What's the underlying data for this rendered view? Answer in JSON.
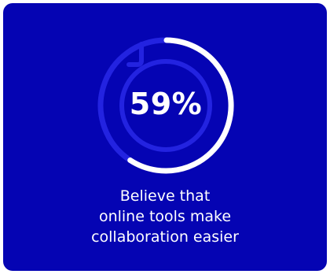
{
  "stat": {
    "value": "59%",
    "percent": 59,
    "caption_lines": [
      "Believe that",
      "online tools make",
      "collaboration easier"
    ]
  },
  "colors": {
    "card_bg": "#0504b3",
    "ring_progress": "#ffffff",
    "ring_track": "#2323e0",
    "text": "#ffffff"
  }
}
